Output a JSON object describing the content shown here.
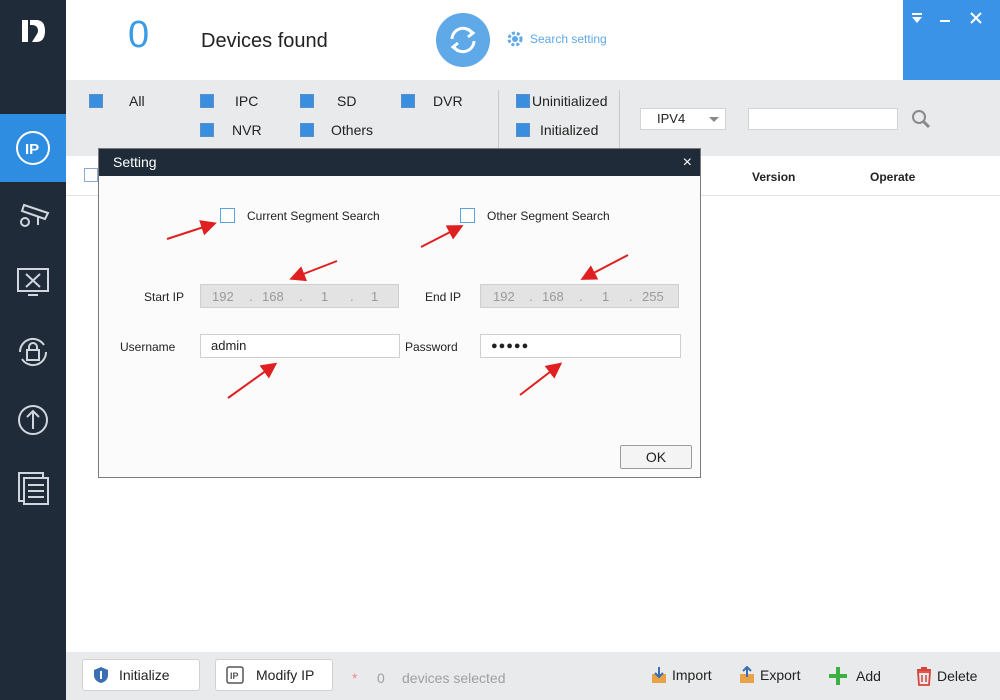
{
  "header": {
    "count": "0",
    "found_label": "Devices found",
    "search_setting": "Search setting"
  },
  "filters": {
    "all": "All",
    "ipc": "IPC",
    "sd": "SD",
    "dvr": "DVR",
    "nvr": "NVR",
    "others": "Others",
    "uninitialized": "Uninitialized",
    "initialized": "Initialized",
    "ip_version": "IPV4",
    "search_value": ""
  },
  "table": {
    "columns": [
      "Version",
      "Operate"
    ]
  },
  "footer": {
    "initialize": "Initialize",
    "modify_ip": "Modify IP",
    "star": "*",
    "selected_count": "0",
    "selected_text": "devices selected",
    "import": "Import",
    "export": "Export",
    "add": "Add",
    "delete": "Delete"
  },
  "dialog": {
    "title": "Setting",
    "close": "×",
    "current_segment": "Current Segment Search",
    "other_segment": "Other Segment Search",
    "start_ip_label": "Start IP",
    "end_ip_label": "End IP",
    "start_ip": [
      "192",
      "168",
      "1",
      "1"
    ],
    "end_ip": [
      "192",
      "168",
      "1",
      "255"
    ],
    "username_label": "Username",
    "username": "admin",
    "password_label": "Password",
    "password": "●●●●●",
    "ok": "OK"
  },
  "colors": {
    "sidebar": "#1f2b38",
    "accent": "#3a93e6",
    "annotation_arrow": "#e02020"
  }
}
